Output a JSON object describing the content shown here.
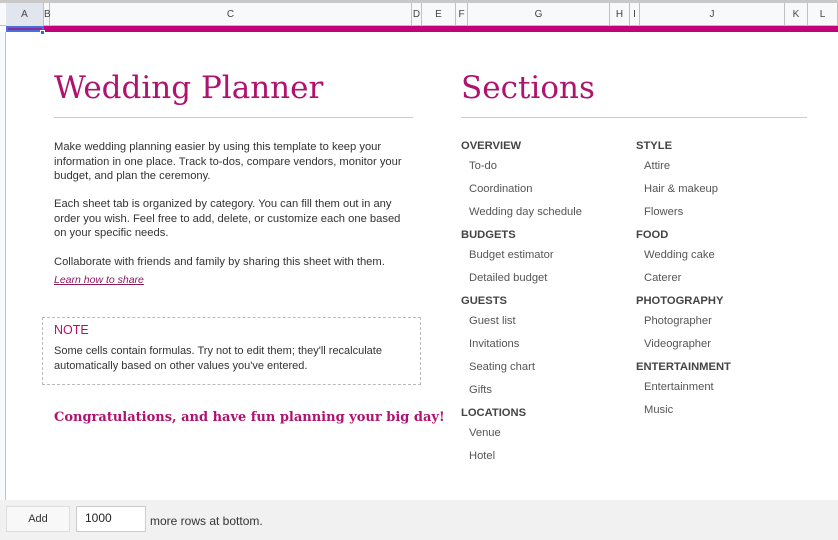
{
  "columns": [
    "A",
    "B",
    "C",
    "D",
    "E",
    "F",
    "G",
    "H",
    "I",
    "J",
    "K",
    "L"
  ],
  "left": {
    "title": "Wedding Planner",
    "paragraphs": [
      "Make wedding planning easier by using this template to keep your information in one place. Track to-dos, compare vendors, monitor your budget, and plan the ceremony.",
      "Each sheet tab is organized by category. You can fill them out in any order you wish. Feel free to add, delete, or customize each one based on your specific needs.",
      "Collaborate with friends and family by sharing this sheet with them."
    ],
    "link": "Learn how to share",
    "note_heading": "NOTE",
    "note_text": "Some cells contain formulas. Try not to edit them; they'll recalculate automatically based on other values you've entered.",
    "congrats": "Congratulations, and have fun planning your big day!"
  },
  "sections": {
    "title": "Sections",
    "col1": [
      {
        "heading": "Overview",
        "items": [
          "To-do",
          "Coordination",
          "Wedding day schedule"
        ]
      },
      {
        "heading": "Budgets",
        "items": [
          "Budget estimator",
          "Detailed budget"
        ]
      },
      {
        "heading": "Guests",
        "items": [
          "Guest list",
          "Invitations",
          "Seating chart",
          "Gifts"
        ]
      },
      {
        "heading": "Locations",
        "items": [
          "Venue",
          "Hotel"
        ]
      }
    ],
    "col2": [
      {
        "heading": "Style",
        "items": [
          "Attire",
          "Hair & makeup",
          "Flowers"
        ]
      },
      {
        "heading": "Food",
        "items": [
          "Wedding cake",
          "Caterer"
        ]
      },
      {
        "heading": "Photography",
        "items": [
          "Photographer",
          "Videographer"
        ]
      },
      {
        "heading": "Entertainment",
        "items": [
          "Entertainment",
          "Music"
        ]
      }
    ]
  },
  "footer": {
    "add_label": "Add",
    "rows_value": "1000",
    "suffix": "more rows at bottom."
  },
  "colors": {
    "accent": "#c2007a"
  }
}
